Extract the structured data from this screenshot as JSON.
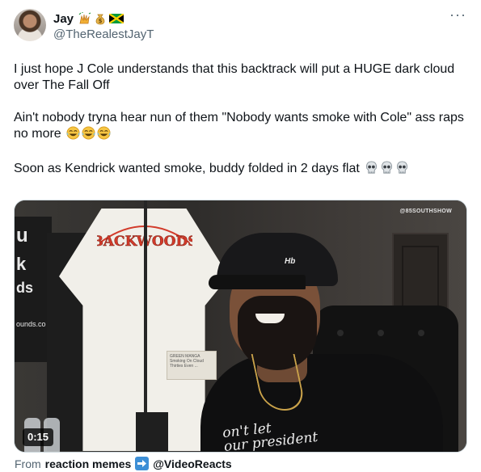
{
  "author": {
    "display_name": "Jay",
    "handle": "@TheRealestJayT",
    "name_emojis": [
      "raised-hands-emoji",
      "money-bag-emoji",
      "jamaica-flag-emoji"
    ]
  },
  "menu": {
    "more_label": "···"
  },
  "tweet": {
    "paragraphs": [
      "I just hope J Cole understands that this backtrack will put a HUGE dark cloud over The Fall Off",
      "Ain't nobody tryna hear nun of them \"Nobody wants smoke with Cole\" ass raps no more",
      "Soon as Kendrick wanted smoke, buddy folded in 2 days flat"
    ],
    "paragraph_emojis": [
      [],
      [
        "tears-of-joy-emoji",
        "tears-of-joy-emoji",
        "tears-of-joy-emoji"
      ],
      [
        "skull-emoji",
        "skull-emoji",
        "skull-emoji"
      ]
    ]
  },
  "media": {
    "watermark": "@85SOUTHSHOW",
    "duration": "0:15",
    "banner_text": [
      "u",
      "k",
      "ds",
      "ounds.co"
    ],
    "shirt_brand": "BACKWOODS",
    "tag_text": "GREEN MANGA Smoking On Cloud Thirties Even ...",
    "cap_logo": "Hb",
    "slogan_lines": [
      "on't let",
      "our president"
    ]
  },
  "attribution": {
    "prefix": "From",
    "source_name": "reaction memes",
    "target_handle": "@VideoReacts",
    "arrow_icon": "arrow-right-icon"
  },
  "colors": {
    "text_primary": "#0f1419",
    "text_secondary": "#536471",
    "border": "#cfd9de",
    "arrow_blue": "#3d8fd6",
    "backwoods_red": "#d23a2a"
  }
}
